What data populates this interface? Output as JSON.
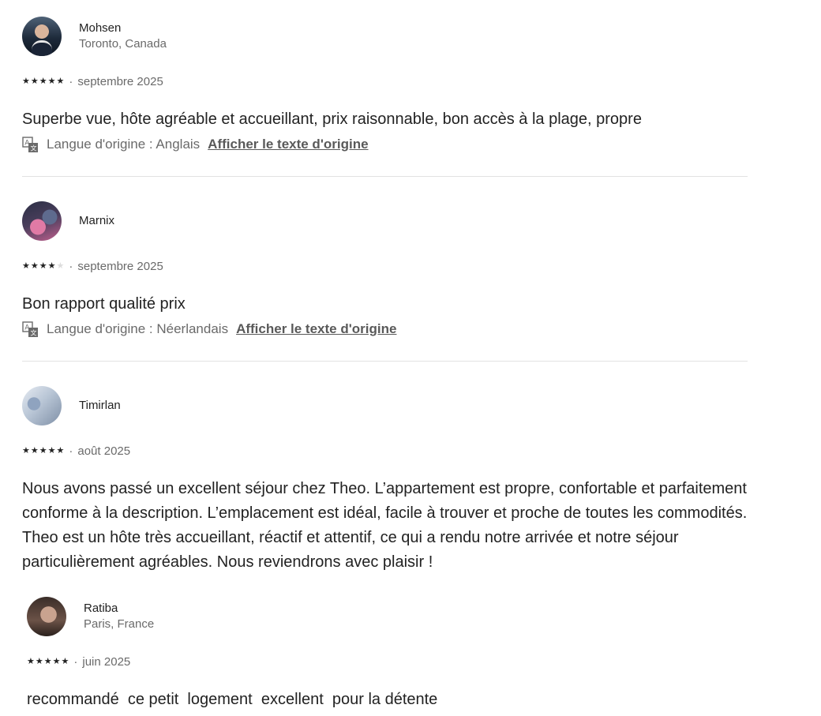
{
  "reviews": [
    {
      "name": "Mohsen",
      "location": "Toronto, Canada",
      "rating": 5,
      "stars_text": "★★★★★",
      "date": "septembre 2025",
      "text": "Superbe vue, hôte agréable et accueillant, prix raisonnable, bon accès à la plage, propre",
      "lang_label": "Langue d'origine : Anglais",
      "show_original": "Afficher le texte d'origine"
    },
    {
      "name": "Marnix",
      "location": "",
      "rating": 4,
      "date": "septembre 2025",
      "text": "Bon rapport qualité prix",
      "lang_label": "Langue d'origine : Néerlandais",
      "show_original": "Afficher le texte d'origine"
    },
    {
      "name": "Timirlan",
      "location": "",
      "rating": 5,
      "date": "août 2025",
      "text": "Nous avons passé un excellent séjour chez Theo. L’appartement est propre, confortable et parfaitement conforme à la description. L’emplacement est idéal, facile à trouver et proche de toutes les commodités. Theo est un hôte très accueillant, réactif et attentif, ce qui a rendu notre arrivée et notre séjour particulièrement agréables. Nous reviendrons avec plaisir !"
    },
    {
      "name": "Ratiba",
      "location": "Paris, France",
      "rating": 5,
      "date": "juin 2025",
      "text": "recommandé  ce petit  logement  excellent  pour la détente"
    }
  ],
  "separator": "·",
  "icons": {
    "star": "star-icon",
    "translate": "translate-icon"
  },
  "colors": {
    "text": "#222222",
    "muted": "#6a6a6a",
    "divider": "#e2e2e2"
  }
}
